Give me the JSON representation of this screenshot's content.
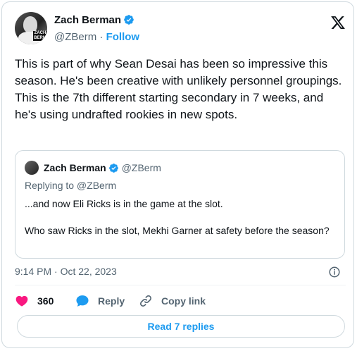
{
  "author": {
    "name": "Zach Berman",
    "handle": "@ZBerm",
    "separator": "·",
    "follow_label": "Follow",
    "avatar_tag": "ZACH BERM"
  },
  "tweet": {
    "text": "This is part of why Sean Desai has been so impressive this season. He's been creative with unlikely personnel groupings. This is the 7th different starting secondary in 7 weeks, and he's using undrafted rookies in new spots.",
    "timestamp": "9:14 PM · Oct 22, 2023"
  },
  "quote": {
    "name": "Zach Berman",
    "handle": "@ZBerm",
    "replying_to": "Replying to @ZBerm",
    "paragraphs": [
      "...and now Eli Ricks is in the game at the slot.",
      "Who saw Ricks in the slot, Mekhi Garner at safety before the season?"
    ]
  },
  "actions": {
    "likes_count": "360",
    "reply_label": "Reply",
    "copy_link_label": "Copy link"
  },
  "read_replies_label": "Read 7 replies",
  "colors": {
    "accent": "#1d9bf0",
    "like": "#f91880",
    "muted": "#536471",
    "border": "#cfd9de"
  },
  "icons": [
    "verified-badge-icon",
    "x-logo-icon",
    "info-icon",
    "heart-icon",
    "reply-bubble-icon",
    "link-icon"
  ]
}
